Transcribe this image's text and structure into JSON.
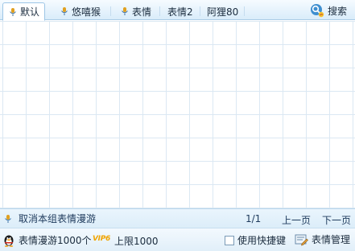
{
  "tabs": [
    {
      "label": "默认",
      "icon": "mic-icon",
      "active": true
    },
    {
      "label": "悠嘻猴",
      "icon": "mic-icon",
      "active": false
    },
    {
      "label": "表情",
      "icon": "mic-icon",
      "active": false
    },
    {
      "label": "表情2",
      "icon": "",
      "active": false
    },
    {
      "label": "阿狸80",
      "icon": "",
      "active": false
    }
  ],
  "search": {
    "label": "搜索",
    "icon": "search-icon"
  },
  "pager": {
    "cancel_label": "取消本组表情漫游",
    "page": "1/1",
    "prev_label": "上一页",
    "next_label": "下一页"
  },
  "status": {
    "roam_count": "表情漫游1000个",
    "vip_badge": "VIP6",
    "limit": "上限1000",
    "shortcut_label": "使用快捷键",
    "shortcut_checked": false,
    "manage_label": "表情管理"
  },
  "colors": {
    "accent": "#2b7fc4",
    "tabbar_bg": "#d9ecfa",
    "grid_line": "#dbe8f3",
    "vip": "#f0a400"
  }
}
